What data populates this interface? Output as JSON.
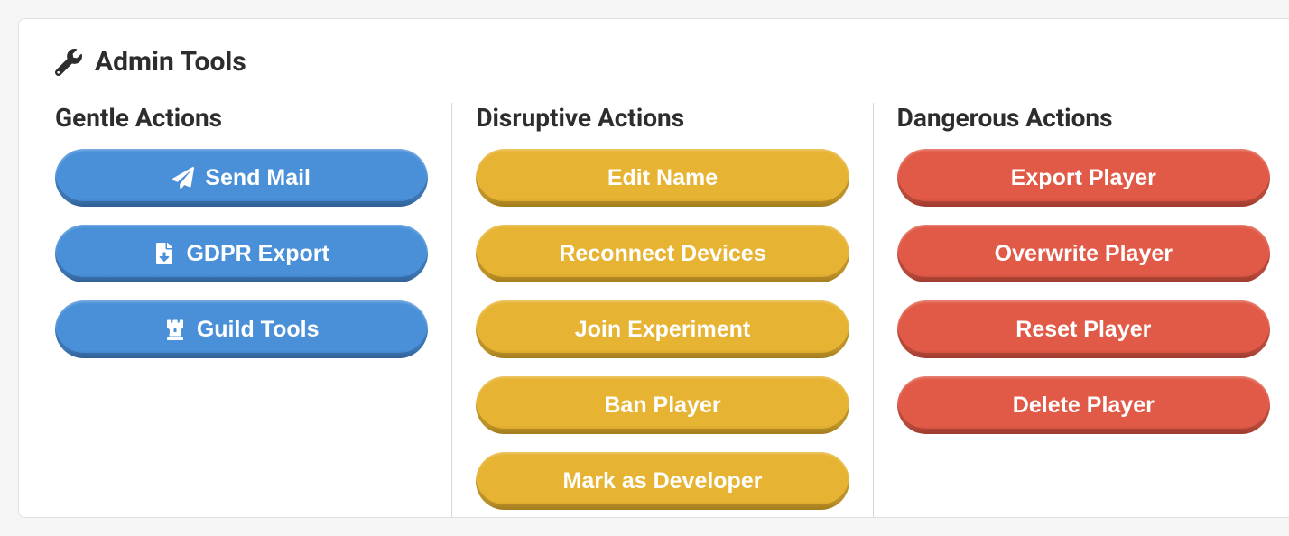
{
  "header": {
    "title": "Admin Tools"
  },
  "columns": {
    "gentle": {
      "title": "Gentle Actions",
      "buttons": {
        "send_mail": "Send Mail",
        "gdpr_export": "GDPR Export",
        "guild_tools": "Guild Tools"
      }
    },
    "disruptive": {
      "title": "Disruptive Actions",
      "buttons": {
        "edit_name": "Edit Name",
        "reconnect_devices": "Reconnect Devices",
        "join_experiment": "Join Experiment",
        "ban_player": "Ban Player",
        "mark_developer": "Mark as Developer"
      }
    },
    "dangerous": {
      "title": "Dangerous Actions",
      "buttons": {
        "export_player": "Export Player",
        "overwrite_player": "Overwrite Player",
        "reset_player": "Reset Player",
        "delete_player": "Delete Player"
      }
    }
  }
}
